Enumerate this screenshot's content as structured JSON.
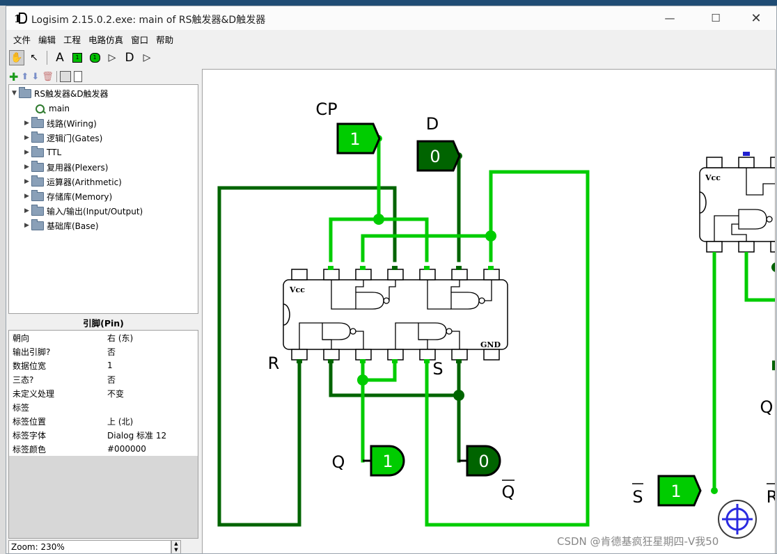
{
  "window": {
    "title": "Logisim 2.15.0.2.exe: main of RS触发器&D触发器"
  },
  "menu": [
    "文件",
    "编辑",
    "工程",
    "电路仿真",
    "窗口",
    "帮助"
  ],
  "toolbar": {
    "tools": [
      "hand-icon",
      "arrow-icon",
      "text-icon",
      "input-pin-icon",
      "output-pin-icon",
      "not-gate-icon",
      "and-gate-icon",
      "or-gate-icon"
    ],
    "input_glyph": "1",
    "output_glyph": "1"
  },
  "tree": {
    "root": "RS触发器&D触发器",
    "circuit": "main",
    "libraries": [
      "线路(Wiring)",
      "逻辑门(Gates)",
      "TTL",
      "复用器(Plexers)",
      "运算器(Arithmetic)",
      "存储库(Memory)",
      "输入/输出(Input/Output)",
      "基础库(Base)"
    ]
  },
  "attributes": {
    "header": "引脚(Pin)",
    "rows": [
      {
        "name": "朝向",
        "value": "右 (东)"
      },
      {
        "name": "输出引脚?",
        "value": "否"
      },
      {
        "name": "数据位宽",
        "value": "1"
      },
      {
        "name": "三态?",
        "value": "否"
      },
      {
        "name": "未定义处理",
        "value": "不变"
      },
      {
        "name": "标签",
        "value": ""
      },
      {
        "name": "标签位置",
        "value": "上 (北)"
      },
      {
        "name": "标签字体",
        "value": "Dialog 标准 12"
      },
      {
        "name": "标签颜色",
        "value": "#000000"
      }
    ]
  },
  "zoom": "Zoom: 230%",
  "circuit": {
    "cp_label": "CP",
    "cp_value": "1",
    "d_label": "D",
    "d_value": "0",
    "vcc": "Vcc",
    "gnd": "GND",
    "r_label": "R",
    "s_label": "S",
    "q_label": "Q",
    "q_value": "1",
    "qbar_label": "Q",
    "qbar_value": "0",
    "chip2_vcc": "Vcc",
    "s2_label": "S",
    "s2_value": "1",
    "q2_label": "Q",
    "r2_label": "R"
  },
  "colors": {
    "wire_on": "#00d200",
    "wire_off": "#006400",
    "pin_on": "#00d200",
    "pin_off": "#006400"
  },
  "watermark": "CSDN @肯德基疯狂星期四-V我50"
}
